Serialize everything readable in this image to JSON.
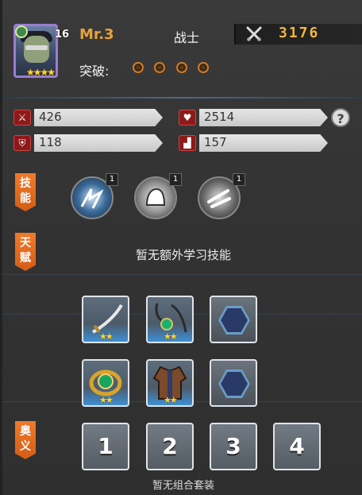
{
  "hero": {
    "level": "16",
    "name": "Mr.3",
    "class": "战士",
    "power": "3176",
    "stars": "★★★★",
    "breakthrough_label": "突破:"
  },
  "stats": {
    "attack": "426",
    "hp": "2514",
    "defense": "118",
    "speed": "157",
    "help": "?"
  },
  "sections": {
    "skills_tag": [
      "技",
      "能"
    ],
    "talent_tag": [
      "天",
      "赋"
    ],
    "mystery_tag": [
      "奥",
      "义"
    ]
  },
  "skills": [
    {
      "name": "skill-1",
      "count": "1"
    },
    {
      "name": "skill-2",
      "count": "1"
    },
    {
      "name": "skill-3",
      "count": "1"
    }
  ],
  "talent": {
    "empty_text": "暂无额外学习技能"
  },
  "equipment": [
    {
      "item": "sword",
      "stars": "★★"
    },
    {
      "item": "necklace",
      "stars": "★★"
    },
    {
      "item": "empty",
      "stars": ""
    },
    {
      "item": "ring",
      "stars": "★★"
    },
    {
      "item": "coat",
      "stars": "★★"
    },
    {
      "item": "empty",
      "stars": ""
    }
  ],
  "combos": [
    "1",
    "2",
    "3",
    "4"
  ],
  "combo_empty_text": "暂无组合套装",
  "colors": {
    "accent": "#e8a23c",
    "tag": "#f07a2a",
    "power": "#f2b73d"
  }
}
